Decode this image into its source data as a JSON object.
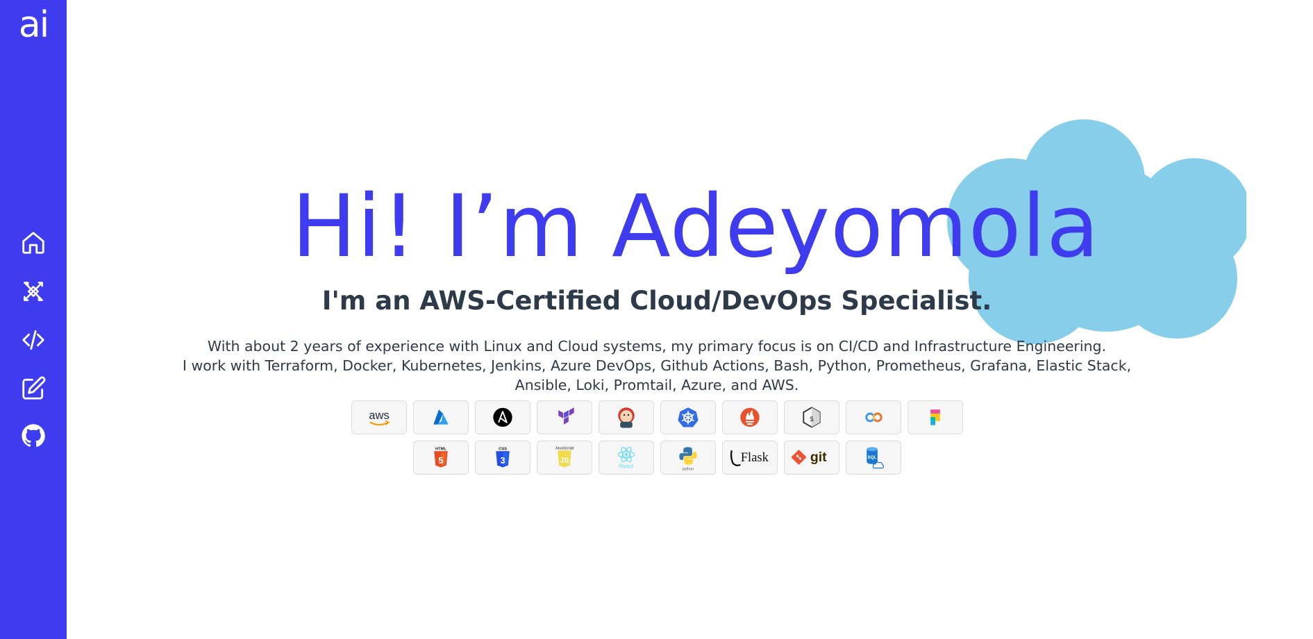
{
  "sidebar": {
    "logo": "ai",
    "nav": [
      {
        "icon": "home-icon"
      },
      {
        "icon": "skills-icon"
      },
      {
        "icon": "code-icon"
      },
      {
        "icon": "edit-icon"
      },
      {
        "icon": "github-icon"
      }
    ],
    "color": "#3f3cef"
  },
  "hero": {
    "title": "Hi! I’m Adeyomola",
    "subtitle": "I'm an AWS-Certified Cloud/DevOps Specialist.",
    "description": [
      "With about 2 years of experience with Linux and Cloud systems, my primary focus is on CI/CD and Infrastructure Engineering.",
      "I work with Terraform, Docker, Kubernetes, Jenkins, Azure DevOps, Github Actions, Bash, Python, Prometheus, Grafana, Elastic Stack,",
      "Ansible, Loki, Promtail, Azure, and AWS."
    ],
    "accent": "#3f3cef",
    "cloud_color": "#87ceeb"
  },
  "tech_badges": {
    "row1": [
      {
        "name": "aws",
        "label": "aws"
      },
      {
        "name": "azure",
        "label": ""
      },
      {
        "name": "ansible",
        "label": ""
      },
      {
        "name": "terraform",
        "label": ""
      },
      {
        "name": "jenkins",
        "label": ""
      },
      {
        "name": "kubernetes",
        "label": ""
      },
      {
        "name": "prometheus",
        "label": ""
      },
      {
        "name": "bash",
        "label": "$"
      },
      {
        "name": "azure-devops",
        "label": ""
      },
      {
        "name": "kibana",
        "label": ""
      }
    ],
    "row2": [
      {
        "name": "html5",
        "label": "HTML"
      },
      {
        "name": "css3",
        "label": "CSS"
      },
      {
        "name": "javascript",
        "label": "JavaScript"
      },
      {
        "name": "react",
        "label": "React"
      },
      {
        "name": "python",
        "label": "python"
      },
      {
        "name": "flask",
        "label": "Flask"
      },
      {
        "name": "git",
        "label": "git"
      },
      {
        "name": "sql",
        "label": "SQL"
      }
    ]
  }
}
